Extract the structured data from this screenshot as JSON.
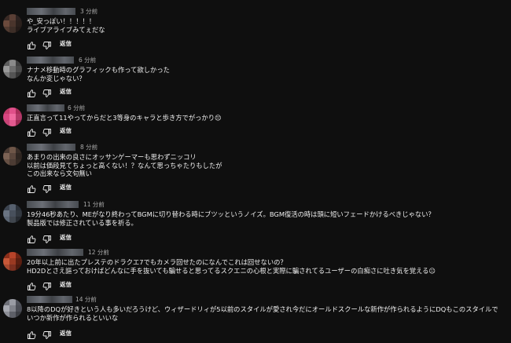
{
  "comments": [
    {
      "time": "3 分前",
      "text": "や_安っぽい！！！！！\nライブアライブみてぇだな",
      "reply_label": "返信",
      "avatar_colors": [
        "#3a2a25",
        "#5a3f35",
        "#2c2220",
        "#6b4a3c",
        "#4a352c",
        "#2a201c",
        "#503a30",
        "#3d2e27",
        "#241b18"
      ]
    },
    {
      "time": "6 分前",
      "text": "ナナメ移動時のグラフィックも作って欲しかった\nなんか変じゃない？",
      "reply_label": "返信",
      "avatar_colors": [
        "#5e5e5e",
        "#8a8a8a",
        "#3e3e3e",
        "#9a9a9a",
        "#6e6e6e",
        "#4a4a4a",
        "#7a7a7a",
        "#545454",
        "#343434"
      ]
    },
    {
      "time": "6 分前",
      "text": "正直言って11やってからだと3等身のキャラと歩き方でがっかり😔",
      "reply_label": "返信",
      "avatar_colors": [
        "#c23a6a",
        "#e0508a",
        "#a82e5a",
        "#d84680",
        "#f06aa0",
        "#b23868",
        "#c84476",
        "#e25a90",
        "#9e2a54"
      ]
    },
    {
      "time": "8 分前",
      "text": "あまりの出来の良さにオッサンゲーマーも思わずニッコリ\n以前は価段見てちょっと高くない！？なんて思っちゃたりもしたが\nこの出来なら文句無い",
      "reply_label": "返信",
      "avatar_colors": [
        "#4a3a32",
        "#6e5648",
        "#3a2e28",
        "#7c6254",
        "#5a463c",
        "#2e2520",
        "#665044",
        "#4c3c34",
        "#342a24"
      ]
    },
    {
      "time": "11 分前",
      "text": "19分46秒あたり、MEがなり終わってBGMに切り替わる時にブツッというノイズ。BGM復活の時は頭に短いフェードかけるべきじゃない？\n製品版では修正されている事を祈る。",
      "reply_label": "返信",
      "avatar_colors": [
        "#3c4450",
        "#56606e",
        "#2a3038",
        "#6a7482",
        "#48505c",
        "#323840",
        "#5c6674",
        "#40464e",
        "#262a30"
      ]
    },
    {
      "time": "12 分前",
      "text": "20年以上前に出たプレステのドラクエ7でもカメラ回せたのになんでこれは回せないの？\nHD2Dとさえ謳っておけばどんなに手を抜いても騙せると思ってるスクエニの心根と実際に騙されてるユーザーの白痴さに吐き気を覚える😐",
      "reply_label": "返信",
      "avatar_colors": [
        "#8a2e1a",
        "#b8442a",
        "#6e2414",
        "#c85838",
        "#9a3a22",
        "#5a1e10",
        "#a84a30",
        "#7c3020",
        "#4c1a0e"
      ]
    },
    {
      "time": "14 分前",
      "text": "8以降のDQが好きという人も多いだろうけど、ウィザードリィが5以前のスタイルが愛され今だにオールドスクールな新作が作られるようにDQもこのスタイルでいつか新作が作られるといいな",
      "reply_label": "返信",
      "avatar_colors": [
        "#6e7078",
        "#9a9ca4",
        "#50525a",
        "#a8aab2",
        "#80828a",
        "#4a4c54",
        "#8c8e96",
        "#5e6068",
        "#3c3e44"
      ]
    }
  ]
}
